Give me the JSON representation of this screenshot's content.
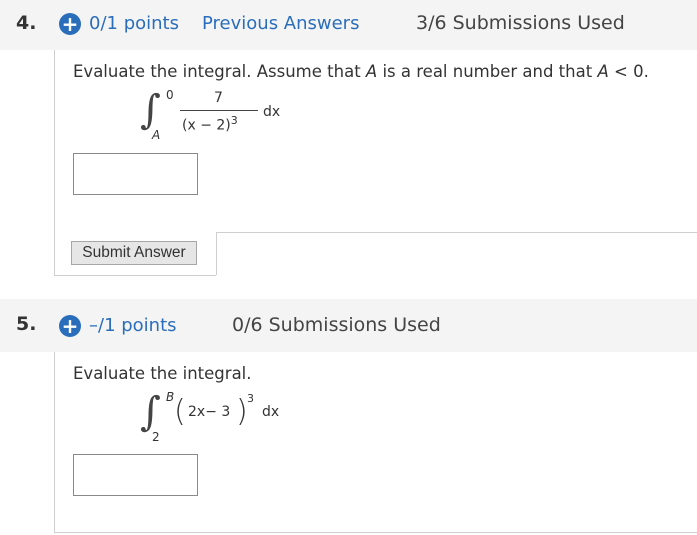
{
  "q4": {
    "number": "4.",
    "plus": "+",
    "points": "0/1 points",
    "previous_answers": "Previous Answers",
    "submissions": "3/6 Submissions Used",
    "prompt_before": "Evaluate the integral. Assume that ",
    "var_a1": "A",
    "prompt_mid": " is a real number and that ",
    "var_a2": "A",
    "prompt_after": " < 0.",
    "integral": {
      "upper": "0",
      "lower": "A",
      "numerator": "7",
      "denominator": "(x − 2)",
      "exponent": "3",
      "differential": "dx"
    },
    "answer_value": "",
    "submit_label": "Submit Answer"
  },
  "q5": {
    "number": "5.",
    "plus": "+",
    "points": "–/1 points",
    "submissions": "0/6 Submissions Used",
    "prompt": "Evaluate the integral.",
    "integral": {
      "upper": "B",
      "lower": "2",
      "integrand": "2x− 3",
      "exponent": "3",
      "differential": "dx"
    },
    "answer_value": ""
  },
  "colors": {
    "link_blue": "#2a6ebb",
    "header_bg": "#f4f4f4"
  },
  "icons": [
    "plus-circle-icon"
  ]
}
